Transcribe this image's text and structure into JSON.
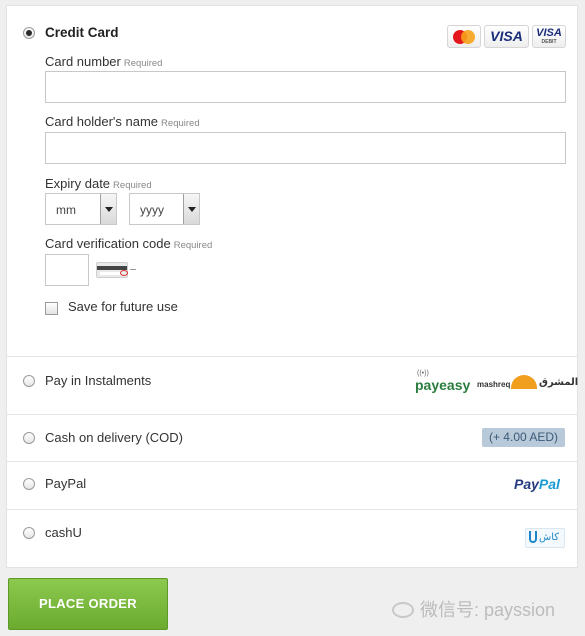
{
  "credit_card": {
    "title": "Credit Card",
    "card_logos": [
      "mastercard-logo",
      "visa-logo",
      "visa-debit-logo"
    ],
    "visa_label": "VISA",
    "visa_debit_label": "VISA",
    "visa_debit_sub": "DEBIT",
    "required_text": "Required",
    "card_number_label": "Card number",
    "card_number_value": "",
    "holder_label": "Card holder's name",
    "holder_value": "",
    "expiry_label": "Expiry date",
    "expiry_month": "mm",
    "expiry_year": "yyyy",
    "cvv_label": "Card verification code",
    "cvv_value": "",
    "save_label": "Save for future use",
    "save_checked": false
  },
  "payment_options": {
    "instalments": {
      "label": "Pay in Instalments",
      "payeasy": "payeasy",
      "mashreq": "mashreq",
      "mashreq_arabic": "المشرق"
    },
    "cod": {
      "label": "Cash on delivery (COD)",
      "fee": "(+ 4.00 AED)"
    },
    "paypal": {
      "label": "PayPal",
      "logo_pay": "Pay",
      "logo_pal": "Pal"
    },
    "cashu": {
      "label": "cashU",
      "logo_text": "كاش"
    }
  },
  "selected_method": "credit_card",
  "place_order": {
    "label": "PLACE ORDER"
  },
  "watermark": {
    "text": "微信号: payssion"
  },
  "colors": {
    "accent_green": "#7cbf3f",
    "fee_badge": "#b8c9d9",
    "paypal_dark": "#253b80",
    "paypal_light": "#179bd7"
  }
}
